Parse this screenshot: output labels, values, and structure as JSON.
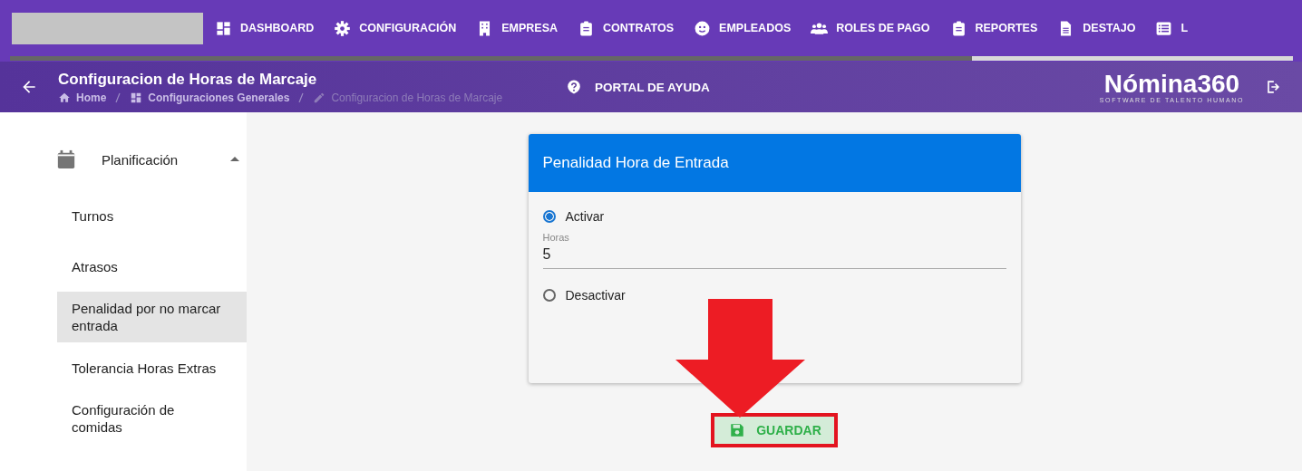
{
  "nav": {
    "items": [
      {
        "label": "DASHBOARD"
      },
      {
        "label": "CONFIGURACIÓN"
      },
      {
        "label": "EMPRESA"
      },
      {
        "label": "CONTRATOS"
      },
      {
        "label": "EMPLEADOS"
      },
      {
        "label": "ROLES DE PAGO"
      },
      {
        "label": "REPORTES"
      },
      {
        "label": "DESTAJO"
      },
      {
        "label": "L"
      }
    ],
    "progress": {
      "level": 0.75
    }
  },
  "header": {
    "title": "Configuracion de Horas de Marcaje",
    "breadcrumbs": [
      {
        "label": "Home",
        "current": false
      },
      {
        "label": "Configuraciones Generales",
        "current": false
      },
      {
        "label": "Configuracion de Horas de Marcaje",
        "current": true
      }
    ],
    "help": "PORTAL DE AYUDA",
    "logo": {
      "name": "Nómina360",
      "tagline": "SOFTWARE DE TALENTO HUMANO"
    }
  },
  "sidebar": {
    "group": {
      "label": "Planificación",
      "expanded": true,
      "children": [
        {
          "label": "Turnos",
          "selected": false
        },
        {
          "label": "Atrasos",
          "selected": false
        },
        {
          "label": "Penalidad por no marcar entrada",
          "selected": true
        },
        {
          "label": "Tolerancia Horas Extras",
          "selected": false
        },
        {
          "label": "Configuración de comidas",
          "selected": false
        }
      ]
    }
  },
  "card": {
    "title": "Penalidad Hora de Entrada",
    "options": [
      {
        "label": "Activar",
        "selected": true
      },
      {
        "label": "Desactivar",
        "selected": false
      }
    ],
    "field": {
      "label": "Horas",
      "value": "5"
    }
  },
  "save_button": "GUARDAR"
}
